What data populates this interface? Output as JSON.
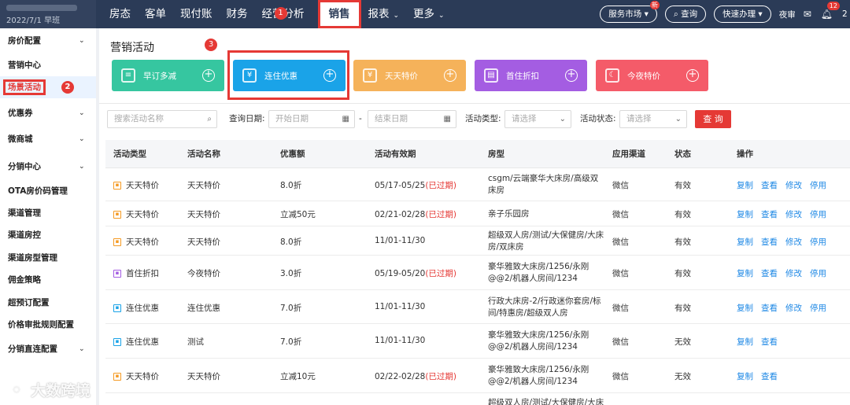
{
  "brand": {
    "date": "2022/7/1 早班"
  },
  "nav": {
    "items": [
      {
        "label": "房态",
        "caret": false,
        "left": 0
      },
      {
        "label": "客单",
        "caret": false
      },
      {
        "label": "现付账",
        "caret": false
      },
      {
        "label": "财务",
        "caret": false
      },
      {
        "label": "经营分析",
        "caret": false
      },
      {
        "label": "销售",
        "caret": false,
        "active": true
      },
      {
        "label": "报表",
        "caret": true
      },
      {
        "label": "更多",
        "caret": true
      }
    ],
    "badge": "1"
  },
  "topright": {
    "market": "服务市场",
    "market_new": "新",
    "search": "查询",
    "quick": "快速办理",
    "night": "夜审",
    "notice_count": "12",
    "cut": "2"
  },
  "sidebar": {
    "items": [
      {
        "label": "房价配置",
        "chevron": true
      },
      {
        "label": "营销中心",
        "chevron": false
      },
      {
        "label": "场景活动",
        "chevron": false,
        "current": true
      },
      {
        "label": "优惠券",
        "chevron": true
      },
      {
        "label": "微商城",
        "chevron": true
      },
      {
        "label": "分销中心",
        "chevron": true
      },
      {
        "label": "OTA房价码管理",
        "chevron": false
      },
      {
        "label": "渠道管理",
        "chevron": false
      },
      {
        "label": "渠道房控",
        "chevron": false
      },
      {
        "label": "渠道房型管理",
        "chevron": false
      },
      {
        "label": "佣金策略",
        "chevron": false
      },
      {
        "label": "超预订配置",
        "chevron": false
      },
      {
        "label": "价格审批规则配置",
        "chevron": false
      },
      {
        "label": "分销直连配置",
        "chevron": true
      }
    ],
    "badge": "2"
  },
  "page": {
    "title": "营销活动"
  },
  "cards": [
    {
      "label": "早订多减",
      "color": "#36c6a0",
      "icon": "receipt-icon"
    },
    {
      "label": "连住优惠",
      "color": "#1aa3e8",
      "icon": "calendar-icon"
    },
    {
      "label": "天天特价",
      "color": "#f5b25a",
      "icon": "yen-tag-icon"
    },
    {
      "label": "首住折扣",
      "color": "#a45de2",
      "icon": "gift-icon"
    },
    {
      "label": "今夜特价",
      "color": "#f45b69",
      "icon": "moon-icon"
    }
  ],
  "card_badge": "3",
  "filter": {
    "name_placeholder": "搜索活动名称",
    "date_label": "查询日期:",
    "start_placeholder": "开始日期",
    "dash": "-",
    "end_placeholder": "结束日期",
    "type_label": "活动类型:",
    "type_placeholder": "请选择",
    "status_label": "活动状态:",
    "status_placeholder": "请选择",
    "query_button": "查 询"
  },
  "table": {
    "headers": [
      "活动类型",
      "活动名称",
      "优惠额",
      "活动有效期",
      "房型",
      "应用渠道",
      "状态",
      "操作"
    ],
    "rows": [
      {
        "type": "天天特价",
        "type_color": "#f59a23",
        "name": "天天特价",
        "discount": "8.0折",
        "period": "05/17-05/25",
        "expired": "(已过期)",
        "room": "csgm/云端豪华大床房/高级双床房",
        "channel": "微信",
        "status": "有效",
        "actions": [
          "复制",
          "查看",
          "修改",
          "停用"
        ]
      },
      {
        "type": "天天特价",
        "type_color": "#f59a23",
        "name": "天天特价",
        "discount": "立减50元",
        "period": "02/21-02/28",
        "expired": "(已过期)",
        "room": "亲子乐园房",
        "channel": "微信",
        "status": "有效",
        "actions": [
          "复制",
          "查看",
          "修改",
          "停用"
        ]
      },
      {
        "type": "天天特价",
        "type_color": "#f59a23",
        "name": "天天特价",
        "discount": "8.0折",
        "period": "11/01-11/30",
        "expired": "",
        "room": "超级双人房/测试/大保健房/大床房/双床房",
        "channel": "微信",
        "status": "有效",
        "actions": [
          "复制",
          "查看",
          "修改",
          "停用"
        ]
      },
      {
        "type": "首住折扣",
        "type_color": "#a45de2",
        "name": "今夜特价",
        "discount": "3.0折",
        "period": "05/19-05/20",
        "expired": "(已过期)",
        "room": "豪华雅致大床房/1256/永刚@@2/机器人房间/1234",
        "channel": "微信",
        "status": "有效",
        "actions": [
          "复制",
          "查看",
          "修改",
          "停用"
        ]
      },
      {
        "type": "连住优惠",
        "type_color": "#1aa3e8",
        "name": "连住优惠",
        "discount": "7.0折",
        "period": "11/01-11/30",
        "expired": "",
        "room": "行政大床房-2/行政迷你套房/标间/特惠房/超级双人房",
        "channel": "微信",
        "status": "有效",
        "actions": [
          "复制",
          "查看",
          "修改",
          "停用"
        ]
      },
      {
        "type": "连住优惠",
        "type_color": "#1aa3e8",
        "name": "测试",
        "discount": "7.0折",
        "period": "11/01-11/30",
        "expired": "",
        "room": "豪华雅致大床房/1256/永刚@@2/机器人房间/1234",
        "channel": "微信",
        "status": "无效",
        "actions": [
          "复制",
          "查看"
        ]
      },
      {
        "type": "天天特价",
        "type_color": "#f59a23",
        "name": "天天特价",
        "discount": "立减10元",
        "period": "02/22-02/28",
        "expired": "(已过期)",
        "room": "豪华雅致大床房/1256/永刚@@2/机器人房间/1234",
        "channel": "微信",
        "status": "无效",
        "actions": [
          "复制",
          "查看"
        ]
      },
      {
        "type": "",
        "type_color": "#f59a23",
        "name": "",
        "discount": "",
        "period": "",
        "expired": "",
        "room": "超级双人房/测试/大保健房/大床",
        "channel": "",
        "status": "",
        "actions": []
      }
    ]
  },
  "watermark": {
    "text": "大数跨境"
  }
}
